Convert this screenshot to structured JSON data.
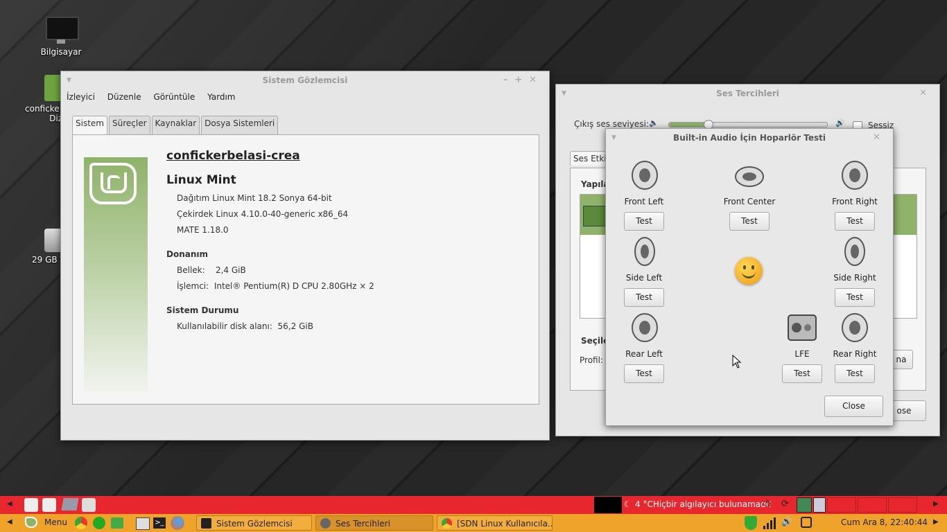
{
  "desktop": {
    "icons": [
      {
        "label": "Bilgisayar"
      },
      {
        "label": "confickerbelasi-crea Dizin"
      },
      {
        "label": "29 GB Birim"
      }
    ],
    "icon_labels_visible": [
      "Bilgisayar",
      "conficke",
      "Diz",
      "29 GB V"
    ]
  },
  "sysmon": {
    "title": "Sistem Gözlemcisi",
    "menu": [
      "İzleyici",
      "Düzenle",
      "Görüntüle",
      "Yardım"
    ],
    "tabs": [
      "Sistem",
      "Süreçler",
      "Kaynaklar",
      "Dosya Sistemleri"
    ],
    "hostname": "confickerbelasi-crea",
    "os_name": "Linux Mint",
    "release": "Dağıtım Linux Mint 18.2 Sonya 64-bit",
    "kernel": "Çekirdek Linux 4.10.0-40-generic x86_64",
    "desktop_env": "MATE 1.18.0",
    "hardware_heading": "Donanım",
    "memory_label": "Bellek:",
    "memory_value": "2,4 GiB",
    "cpu_label": "İşlemci:",
    "cpu_value": "Intel® Pentium(R) D CPU 2.80GHz × 2",
    "status_heading": "Sistem Durumu",
    "disk_label": "Kullanılabilir disk alanı:",
    "disk_value": "56,2 GiB"
  },
  "sound": {
    "title": "Ses Tercihleri",
    "volume_label": "Çıkış ses seviyesi:",
    "volume_level": 0.25,
    "mute_label": "Sessiz",
    "tab_partial": "Ses Etkil",
    "section_partial": "Yapıla",
    "selected_partial": "Seçile",
    "profile_label": "Profil:",
    "button_partial": "na",
    "close_partial": "ose"
  },
  "speaker_test": {
    "title": "Built-in Audio İçin Hoparlör Testi",
    "speakers": {
      "front_left": "Front Left",
      "front_center": "Front Center",
      "front_right": "Front Right",
      "side_left": "Side Left",
      "side_right": "Side Right",
      "rear_left": "Rear Left",
      "lfe": "LFE",
      "rear_right": "Rear Right"
    },
    "test_label": "Test",
    "close_label": "Close"
  },
  "top_panel": {
    "weather": "4 °CHiçbir algılayıcı bulunamadı!"
  },
  "bottom_panel": {
    "menu_label": "Menu",
    "tasks": [
      "Sistem Gözlemcisi",
      "Ses Tercihleri",
      "[SDN Linux Kullanıcıla..."
    ],
    "clock": "Cum Ara  8, 22:40:44"
  },
  "colors": {
    "mint_green": "#8fb369",
    "top_panel": "#e8262d",
    "bottom_panel": "#f0a32a"
  }
}
